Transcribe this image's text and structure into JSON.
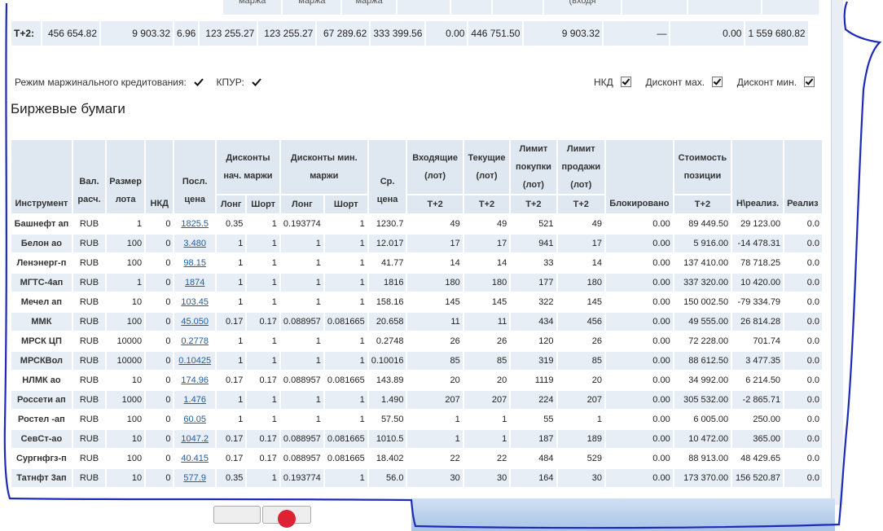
{
  "totals_header": [
    "маржа",
    "маржа",
    "маржа",
    "(входя"
  ],
  "totals": {
    "label": "T+2:",
    "values": [
      "456 654.82",
      "9 903.32",
      "6.96",
      "123 255.27",
      "123 255.27",
      "67 289.62",
      "333 399.56",
      "0.00",
      "446 751.50",
      "9 903.32",
      "—",
      "0.00",
      "1 559 680.82"
    ]
  },
  "flags": {
    "margin_mode_label": "Режим маржинального кредитования:",
    "kpur_label": "КПУР:",
    "nkd_label": "НКД",
    "discount_max_label": "Дисконт мах.",
    "discount_min_label": "Дисконт мин."
  },
  "section_title": "Биржевые бумаги",
  "columns": {
    "instrument": "Инструмент",
    "currency": "Вал. расч.",
    "lot_size": "Размер лота",
    "nkd": "НКД",
    "last_price": "Посл. цена",
    "disc_init": "Дисконты нач. маржи",
    "disc_min": "Дисконты мин. маржи",
    "long": "Лонг",
    "short": "Шорт",
    "avg_price": "Ср. цена",
    "incoming": "Входящие (лот)",
    "current": "Текущие (лот)",
    "buy_limit": "Лимит покупки (лот)",
    "sell_limit": "Лимит продажи (лот)",
    "blocked": "Блокировано",
    "position_value": "Стоимость позиции",
    "unrealized": "Н\\реализ.",
    "realized": "Реализ",
    "t2": "T+2"
  },
  "rows": [
    [
      "Башнефт ап",
      "RUB",
      "1",
      "0",
      "1825.5",
      "0.35",
      "1",
      "0.193774",
      "1",
      "1230.7",
      "49",
      "49",
      "521",
      "49",
      "0.00",
      "89 449.50",
      "29 123.00",
      "0.0"
    ],
    [
      "Белон ао",
      "RUB",
      "100",
      "0",
      "3.480",
      "1",
      "1",
      "1",
      "1",
      "12.017",
      "17",
      "17",
      "941",
      "17",
      "0.00",
      "5 916.00",
      "-14 478.31",
      "0.0"
    ],
    [
      "Ленэнерг-п",
      "RUB",
      "100",
      "0",
      "98.15",
      "1",
      "1",
      "1",
      "1",
      "41.77",
      "14",
      "14",
      "33",
      "14",
      "0.00",
      "137 410.00",
      "78 718.25",
      "0.0"
    ],
    [
      "МГТС-4ап",
      "RUB",
      "1",
      "0",
      "1874",
      "1",
      "1",
      "1",
      "1",
      "1816",
      "180",
      "180",
      "177",
      "180",
      "0.00",
      "337 320.00",
      "10 420.00",
      "0.0"
    ],
    [
      "Мечел ап",
      "RUB",
      "10",
      "0",
      "103.45",
      "1",
      "1",
      "1",
      "1",
      "158.16",
      "145",
      "145",
      "322",
      "145",
      "0.00",
      "150 002.50",
      "-79 334.79",
      "0.0"
    ],
    [
      "ММК",
      "RUB",
      "100",
      "0",
      "45.050",
      "0.17",
      "0.17",
      "0.088957",
      "0.081665",
      "20.658",
      "11",
      "11",
      "434",
      "456",
      "0.00",
      "49 555.00",
      "26 814.28",
      "0.0"
    ],
    [
      "МРСК ЦП",
      "RUB",
      "10000",
      "0",
      "0.2778",
      "1",
      "1",
      "1",
      "1",
      "0.2748",
      "26",
      "26",
      "120",
      "26",
      "0.00",
      "72 228.00",
      "701.74",
      "0.0"
    ],
    [
      "МРСКВол",
      "RUB",
      "10000",
      "0",
      "0.10425",
      "1",
      "1",
      "1",
      "1",
      "0.10016",
      "85",
      "85",
      "319",
      "85",
      "0.00",
      "88 612.50",
      "3 477.35",
      "0.0"
    ],
    [
      "НЛМК ао",
      "RUB",
      "10",
      "0",
      "174.96",
      "0.17",
      "0.17",
      "0.088957",
      "0.081665",
      "143.89",
      "20",
      "20",
      "1119",
      "20",
      "0.00",
      "34 992.00",
      "6 214.50",
      "0.0"
    ],
    [
      "Россети ап",
      "RUB",
      "1000",
      "0",
      "1.476",
      "1",
      "1",
      "1",
      "1",
      "1.490",
      "207",
      "207",
      "224",
      "207",
      "0.00",
      "305 532.00",
      "-2 865.71",
      "0.0"
    ],
    [
      "Ростел -ап",
      "RUB",
      "100",
      "0",
      "60.05",
      "1",
      "1",
      "1",
      "1",
      "57.50",
      "1",
      "1",
      "55",
      "1",
      "0.00",
      "6 005.00",
      "250.00",
      "0.0"
    ],
    [
      "СевСт-ао",
      "RUB",
      "10",
      "0",
      "1047.2",
      "0.17",
      "0.17",
      "0.088957",
      "0.081665",
      "1010.5",
      "1",
      "1",
      "187",
      "189",
      "0.00",
      "10 472.00",
      "365.00",
      "0.0"
    ],
    [
      "Сургнфгз-п",
      "RUB",
      "100",
      "0",
      "40.415",
      "0.17",
      "0.17",
      "0.088957",
      "0.081665",
      "18.402",
      "22",
      "22",
      "484",
      "529",
      "0.00",
      "88 913.00",
      "48 429.65",
      "0.0"
    ],
    [
      "Татнфт 3ап",
      "RUB",
      "10",
      "0",
      "577.9",
      "0.35",
      "1",
      "0.193774",
      "1",
      "56.0",
      "30",
      "30",
      "164",
      "30",
      "0.00",
      "173 370.00",
      "156 520.87",
      "0.0"
    ]
  ]
}
